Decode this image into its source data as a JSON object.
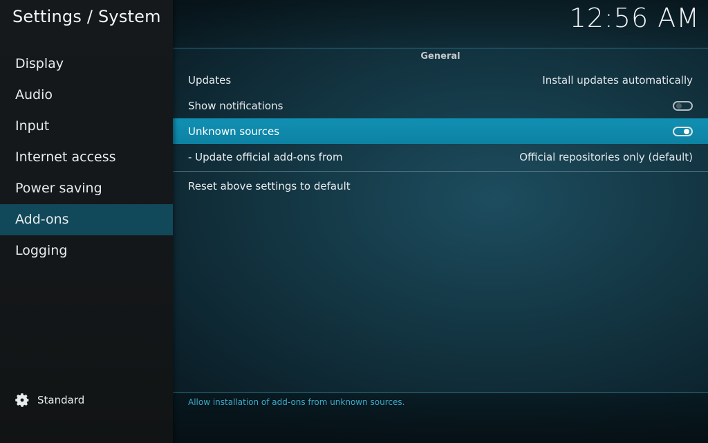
{
  "header": {
    "title": "Settings / System",
    "clock": "12:56 AM"
  },
  "sidebar": {
    "items": [
      {
        "label": "Display",
        "active": false
      },
      {
        "label": "Audio",
        "active": false
      },
      {
        "label": "Input",
        "active": false
      },
      {
        "label": "Internet access",
        "active": false
      },
      {
        "label": "Power saving",
        "active": false
      },
      {
        "label": "Add-ons",
        "active": true
      },
      {
        "label": "Logging",
        "active": false
      }
    ],
    "settings_level": {
      "icon": "gear-icon",
      "label": "Standard"
    }
  },
  "main": {
    "group_title": "General",
    "settings": [
      {
        "label": "Updates",
        "value": "Install updates automatically"
      },
      {
        "label": "Show notifications",
        "toggle": "off"
      },
      {
        "label": "Unknown sources",
        "toggle": "on",
        "selected": true
      },
      {
        "label": "- Update official add-ons from",
        "value": "Official repositories only (default)"
      }
    ],
    "reset_label": "Reset above settings to default",
    "description": "Allow installation of add-ons from unknown sources."
  },
  "colors": {
    "selection": "#0f86a8",
    "sidebar_active": "#12495a",
    "description_text": "#3aa9c8",
    "accent_line": "#2f7e90"
  }
}
